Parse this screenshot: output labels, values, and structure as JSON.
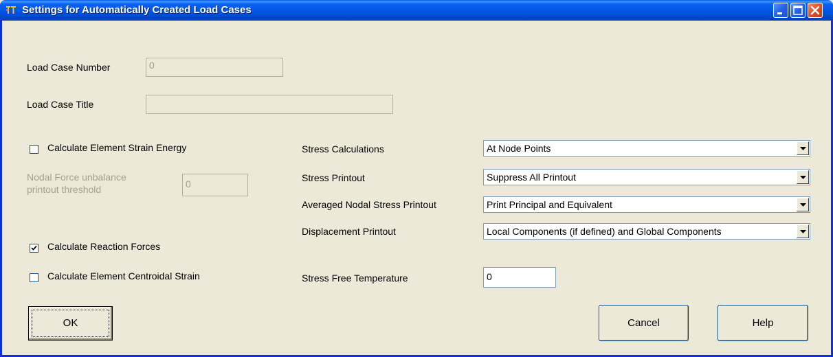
{
  "window": {
    "title": "Settings for Automatically Created Load Cases"
  },
  "fields": {
    "load_case_number_label": "Load Case Number",
    "load_case_number_value": "0",
    "load_case_title_label": "Load Case Title",
    "load_case_title_value": "",
    "nodal_force_label_line1": "Nodal Force unbalance",
    "nodal_force_label_line2": "printout threshold",
    "nodal_force_value": "0",
    "stress_free_temp_label": "Stress Free Temperature",
    "stress_free_temp_value": "0"
  },
  "checkboxes": {
    "strain_energy": {
      "label": "Calculate Element Strain Energy",
      "checked": false
    },
    "reaction_forces": {
      "label": "Calculate Reaction Forces",
      "checked": true
    },
    "centroidal_strain": {
      "label": "Calculate Element Centroidal Strain",
      "checked": false
    }
  },
  "dropdowns": {
    "stress_calculations": {
      "label": "Stress Calculations",
      "value": "At Node Points"
    },
    "stress_printout": {
      "label": "Stress Printout",
      "value": "Suppress All Printout"
    },
    "averaged_nodal": {
      "label": "Averaged Nodal Stress Printout",
      "value": "Print Principal and Equivalent"
    },
    "displacement": {
      "label": "Displacement Printout",
      "value": "Local Components (if defined) and Global Components"
    }
  },
  "buttons": {
    "ok": "OK",
    "cancel": "Cancel",
    "help": "Help"
  },
  "colors": {
    "titlebar": "#0055e5",
    "dialog_bg": "#ece9d8",
    "disabled_text": "#a4a08c"
  }
}
